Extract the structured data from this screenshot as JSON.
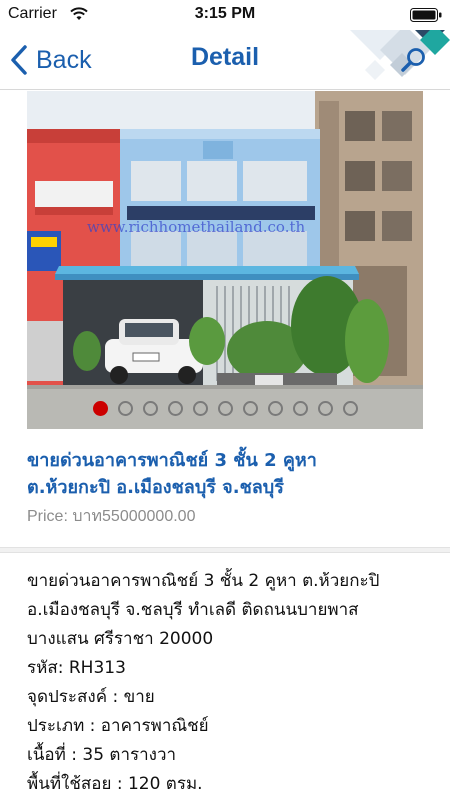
{
  "status_bar": {
    "carrier": "Carrier",
    "time": "3:15 PM"
  },
  "nav": {
    "back_label": "Back",
    "title": "Detail",
    "accent_color": "#1b5fae"
  },
  "photo": {
    "watermark": "www.richhomethailand.co.th",
    "page_count": 11,
    "active_page": 1
  },
  "listing": {
    "title_line1": "ขายด่วนอาคารพาณิชย์ 3 ชั้น 2 คูหา",
    "title_line2": "ต.ห้วยกะปิ อ.เมืองชลบุรี จ.ชลบุรี",
    "price": "Price: บาท55000000.00"
  },
  "description": {
    "line1": "ขายด่วนอาคารพาณิชย์ 3 ชั้น 2 คูหา ต.ห้วยกะปิ",
    "line2": "อ.เมืองชลบุรี จ.ชลบุรี ทำเลดี ติดถนนบายพาส",
    "line3": "บางแสน ศรีราชา 20000",
    "line4": "รหัส: RH313",
    "line5": "จุดประสงค์ : ขาย",
    "line6": "ประเภท : อาคารพาณิชย์",
    "line7": "เนื้อที่ : 35 ตารางวา",
    "line8": "พื้นที่ใช้สอย : 120 ตรม."
  }
}
